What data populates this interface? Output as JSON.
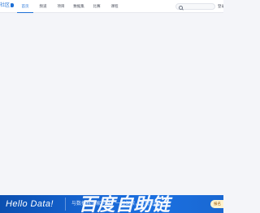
{
  "header": {
    "brand": "社区",
    "tabs": [
      {
        "label": "首页",
        "active": true
      },
      {
        "label": "频道",
        "active": false
      },
      {
        "label": "项目",
        "active": false
      },
      {
        "label": "数据集",
        "active": false
      },
      {
        "label": "比赛",
        "active": false
      },
      {
        "label": "课程",
        "active": false
      }
    ],
    "search": {
      "placeholder": "",
      "value": ""
    },
    "login_label": "登录"
  },
  "banner": {
    "hello_text": "Hello Data!",
    "wordmark": "百度自助链",
    "tagline": "与数据科学家同行，一起探索，发现无限",
    "button_label": "报名"
  },
  "colors": {
    "accent": "#1d6fd6",
    "banner_blue": "#1767d6",
    "page_bg": "#f4f5f9"
  }
}
